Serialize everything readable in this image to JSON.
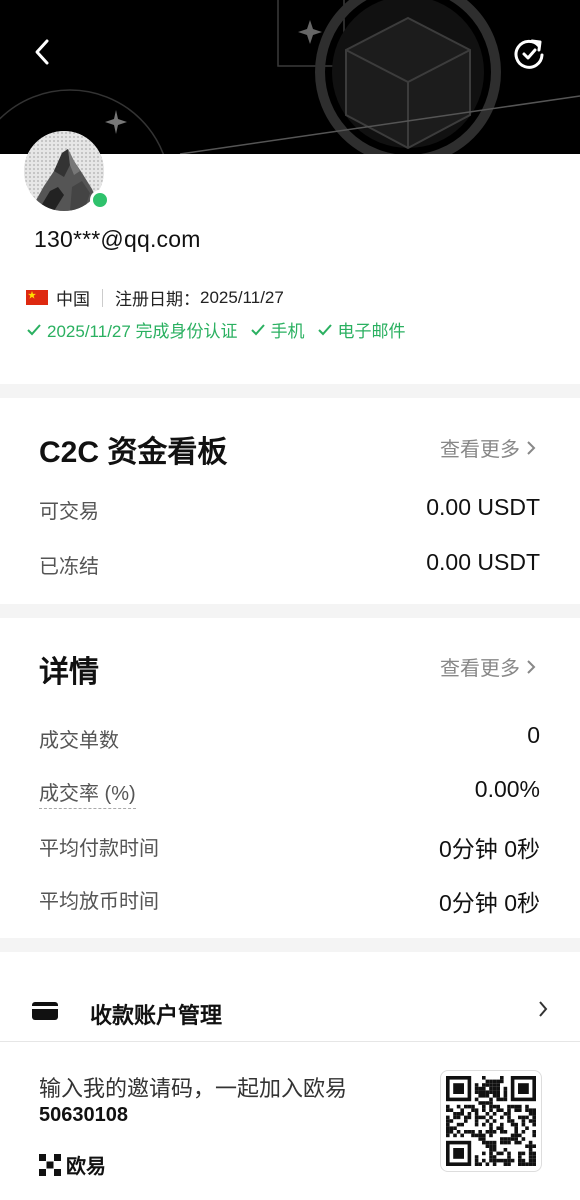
{
  "header": {
    "back_icon": "chevron-left-icon",
    "refresh_icon": "refresh-icon"
  },
  "profile": {
    "email": "130***@qq.com",
    "country": "中国",
    "register_label": "注册日期：",
    "register_date": "2025/11/27",
    "verifications": [
      "2025/11/27 完成身份认证",
      "手机",
      "电子邮件"
    ],
    "status_color": "#2fc26c"
  },
  "funds": {
    "title": "C2C 资金看板",
    "more": "查看更多",
    "rows": [
      {
        "label": "可交易",
        "value": "0.00 USDT"
      },
      {
        "label": "已冻结",
        "value": "0.00 USDT"
      }
    ]
  },
  "details": {
    "title": "详情",
    "more": "查看更多",
    "rows": [
      {
        "label": "成交单数",
        "value": "0"
      },
      {
        "label": "成交率 (%)",
        "value": "0.00%"
      },
      {
        "label": "平均付款时间",
        "value": "0分钟 0秒"
      },
      {
        "label": "平均放币时间",
        "value": "0分钟 0秒"
      }
    ]
  },
  "account": {
    "label": "收款账户管理",
    "icon": "card-icon"
  },
  "invite": {
    "text": "输入我的邀请码，一起加入欧易",
    "code": "50630108",
    "brand": "欧易"
  }
}
